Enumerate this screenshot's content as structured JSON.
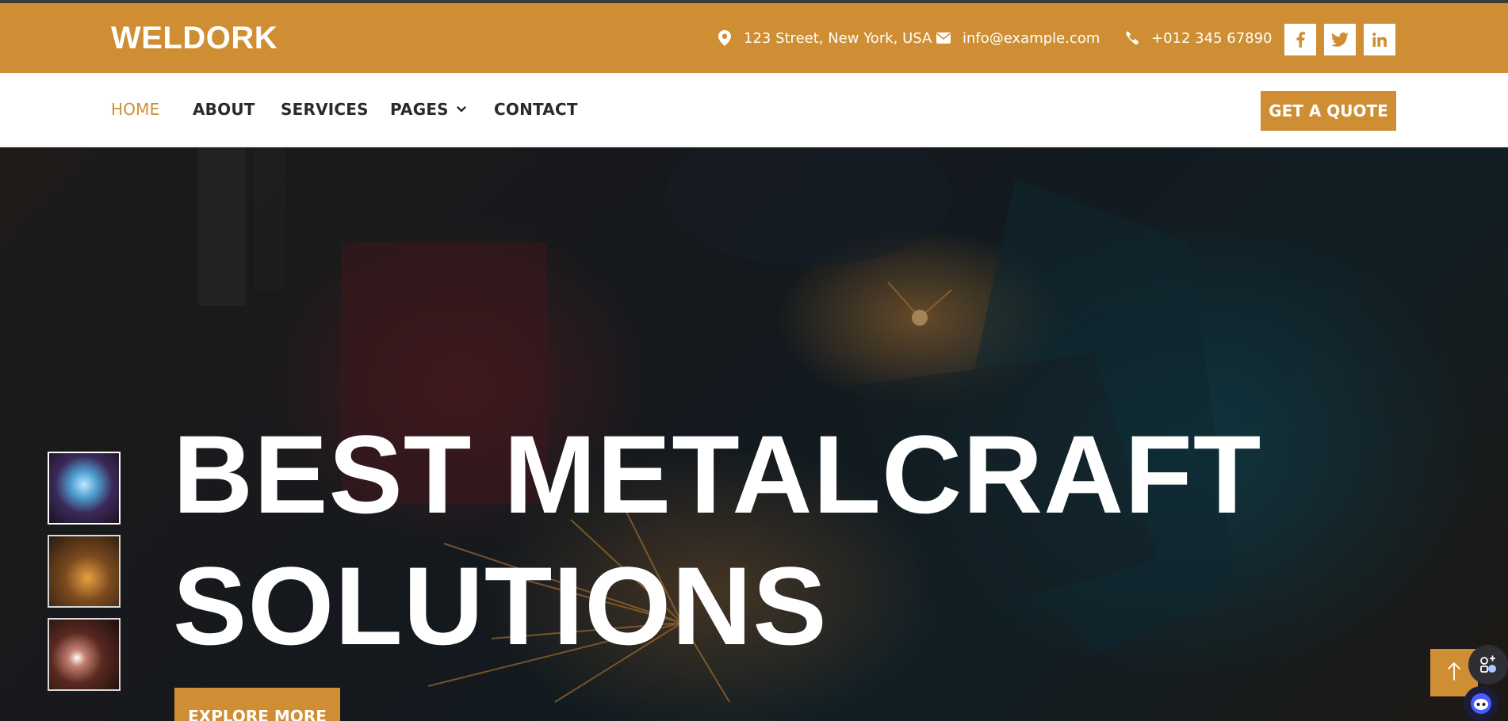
{
  "header": {
    "brand": "WELDORK",
    "address": "123 Street, New York, USA",
    "email": "info@example.com",
    "phone": "+012 345 67890",
    "icons": {
      "address": "map-marker-icon",
      "email": "envelope-icon",
      "phone": "phone-icon"
    },
    "social": [
      {
        "name": "facebook-icon",
        "glyph": "f"
      },
      {
        "name": "twitter-icon",
        "glyph": "t"
      },
      {
        "name": "linkedin-icon",
        "glyph": "in"
      }
    ]
  },
  "nav": {
    "items": [
      {
        "label": "HOME",
        "active": true
      },
      {
        "label": "ABOUT",
        "active": false
      },
      {
        "label": "SERVICES",
        "active": false
      },
      {
        "label": "PAGES",
        "active": false,
        "dropdown": true
      },
      {
        "label": "CONTACT",
        "active": false
      }
    ],
    "cta_label": "GET A QUOTE"
  },
  "hero": {
    "title_line1": "BEST METALCRAFT",
    "title_line2": "SOLUTIONS",
    "button_label": "EXPLORE MORE",
    "thumbnails": [
      {
        "name": "welding-sparks-thumb",
        "active": true
      },
      {
        "name": "grinding-thumb",
        "active": false
      },
      {
        "name": "metal-cutting-thumb",
        "active": false
      }
    ],
    "background": "welder-working-photo"
  },
  "floating": {
    "back_to_top_icon": "arrow-up-icon"
  },
  "colors": {
    "accent": "#cf8e33",
    "text_dark": "#2a2a2a",
    "white": "#ffffff"
  }
}
